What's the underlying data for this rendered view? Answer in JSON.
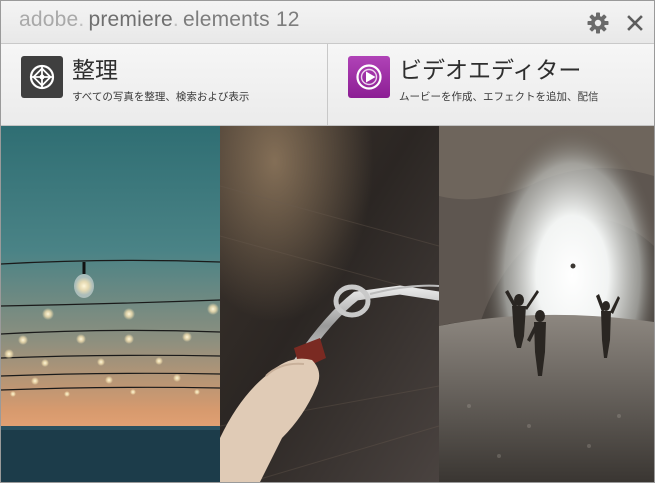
{
  "titlebar": {
    "title_word1": "adobe",
    "title_word2": "premiere",
    "title_word3": "elements 12",
    "settings_icon": "gear-icon",
    "close_icon": "close-icon"
  },
  "organizer": {
    "title": "整理",
    "description": "すべての写真を整理、検索および表示",
    "icon": "organizer-icon"
  },
  "video_editor": {
    "title": "ビデオエディター",
    "description": "ムービーを作成、エフェクトを追加、配信",
    "icon": "video-editor-icon"
  },
  "colors": {
    "organizer_icon_bg": "#3f3f3f",
    "editor_icon_bg": "#9c2aa3",
    "titlebar_text": "#8d8d8d"
  }
}
